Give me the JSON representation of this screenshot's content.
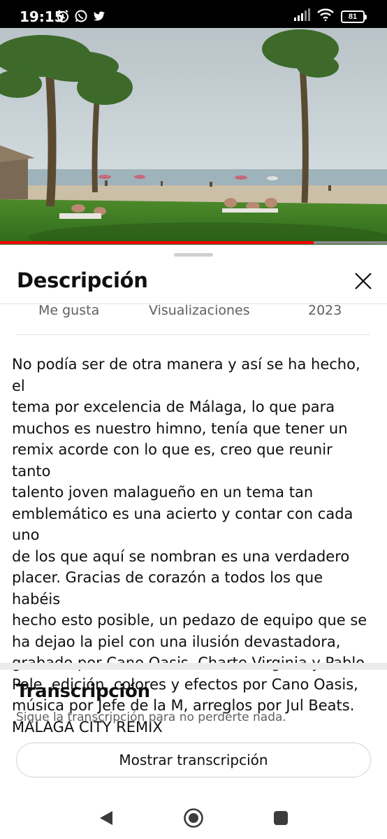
{
  "status_bar": {
    "time": "19:15",
    "battery": "81",
    "icons_left": [
      "alarm-icon",
      "whatsapp-icon",
      "twitter-icon"
    ],
    "icons_right": [
      "signal-icon",
      "wifi-icon",
      "battery-icon"
    ]
  },
  "video": {
    "progress_percent": 81,
    "accent_color": "#ff0000"
  },
  "sheet": {
    "title": "Descripción",
    "stats": {
      "likes_label": "Me gusta",
      "views_label": "Visualizaciones",
      "year": "2023"
    },
    "description": "No podía ser de otra manera y así se ha hecho, el\ntema por excelencia de Málaga, lo que para\nmuchos es nuestro himno, tenía que tener un\nremix acorde con lo que es, creo que reunir tanto\ntalento joven malagueño en un tema tan\nemblemático es una acierto y contar con cada uno\nde los que aquí se nombran es una verdadero\nplacer. Gracias de corazón a todos los que habéis\nhecho esto posible, un pedazo de equipo que se\nha dejao la piel con una ilusión devastadora,\ngrabado por Cano Oasis, Charte Virginia y Pablo\nPole, edición, colores y efectos por Cano Oasis,\nmúsica por Jefe de la M, arreglos por Jul Beats.\nMALAGA CITY REMIX"
  },
  "transcript": {
    "title": "Transcripción",
    "subtitle": "Sigue la transcripción para no perderte nada.",
    "button_label": "Mostrar transcripción"
  },
  "nav": {
    "icons": [
      "back-icon",
      "home-icon",
      "recents-icon"
    ]
  }
}
